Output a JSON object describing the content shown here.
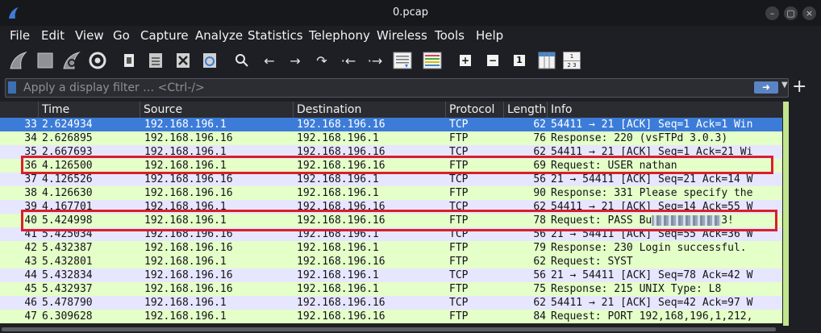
{
  "window": {
    "title": "0.pcap",
    "controls": [
      "minimize",
      "maximize",
      "close"
    ],
    "accent": "#3c7cd8"
  },
  "menu": [
    "File",
    "Edit",
    "View",
    "Go",
    "Capture",
    "Analyze",
    "Statistics",
    "Telephony",
    "Wireless",
    "Tools",
    "Help"
  ],
  "toolbar": {
    "icons": [
      "shark-fin-start-icon",
      "stop-square-icon",
      "restart-fin-icon",
      "gear-options-icon",
      "open-file-icon",
      "save-file-icon",
      "close-file-icon",
      "reload-icon",
      "search-icon",
      "arrow-left-icon",
      "arrow-right-icon",
      "go-to-packet-icon",
      "first-packet-icon",
      "last-packet-icon",
      "autoscroll-icon",
      "colorize-icon",
      "zoom-in-icon",
      "zoom-out-icon",
      "normal-size-icon",
      "resize-columns-icon",
      "layout-icon"
    ],
    "zoom_in": "+",
    "zoom_out": "−",
    "normal_size": "1",
    "layout_top": "1",
    "layout_bottom": "2 3"
  },
  "filter": {
    "placeholder": "Apply a display filter … <Ctrl-/>",
    "apply_icon": "arrow-right-icon",
    "add_button": "+"
  },
  "columns": {
    "no": "",
    "time": "Time",
    "source": "Source",
    "destination": "Destination",
    "protocol": "Protocol",
    "length": "Length",
    "info": "Info"
  },
  "packets": [
    {
      "no": "33",
      "time": "2.624934",
      "source": "192.168.196.1",
      "destination": "192.168.196.16",
      "protocol": "TCP",
      "length": "62",
      "info": "54411 → 21 [ACK] Seq=1 Ack=1 Win"
    },
    {
      "no": "34",
      "time": "2.626895",
      "source": "192.168.196.16",
      "destination": "192.168.196.1",
      "protocol": "FTP",
      "length": "76",
      "info": "Response: 220 (vsFTPd 3.0.3)"
    },
    {
      "no": "35",
      "time": "2.667693",
      "source": "192.168.196.1",
      "destination": "192.168.196.16",
      "protocol": "TCP",
      "length": "62",
      "info": "54411 → 21 [ACK] Seq=1 Ack=21 Wi"
    },
    {
      "no": "36",
      "time": "4.126500",
      "source": "192.168.196.1",
      "destination": "192.168.196.16",
      "protocol": "FTP",
      "length": "69",
      "info": "Request: USER nathan"
    },
    {
      "no": "37",
      "time": "4.126526",
      "source": "192.168.196.16",
      "destination": "192.168.196.1",
      "protocol": "TCP",
      "length": "56",
      "info": "21 → 54411 [ACK] Seq=21 Ack=14 W"
    },
    {
      "no": "38",
      "time": "4.126630",
      "source": "192.168.196.16",
      "destination": "192.168.196.1",
      "protocol": "FTP",
      "length": "90",
      "info": "Response: 331 Please specify the"
    },
    {
      "no": "39",
      "time": "4.167701",
      "source": "192.168.196.1",
      "destination": "192.168.196.16",
      "protocol": "TCP",
      "length": "62",
      "info": "54411 → 21 [ACK] Seq=14 Ack=55 W"
    },
    {
      "no": "40",
      "time": "5.424998",
      "source": "192.168.196.1",
      "destination": "192.168.196.16",
      "protocol": "FTP",
      "length": "78",
      "info": "Request: PASS Bu",
      "info_suffix": "3!"
    },
    {
      "no": "41",
      "time": "5.425034",
      "source": "192.168.196.16",
      "destination": "192.168.196.1",
      "protocol": "TCP",
      "length": "56",
      "info": "21 → 54411 [ACK] Seq=55 Ack=36 W"
    },
    {
      "no": "42",
      "time": "5.432387",
      "source": "192.168.196.16",
      "destination": "192.168.196.1",
      "protocol": "FTP",
      "length": "79",
      "info": "Response: 230 Login successful."
    },
    {
      "no": "43",
      "time": "5.432801",
      "source": "192.168.196.1",
      "destination": "192.168.196.16",
      "protocol": "FTP",
      "length": "62",
      "info": "Request: SYST"
    },
    {
      "no": "44",
      "time": "5.432834",
      "source": "192.168.196.16",
      "destination": "192.168.196.1",
      "protocol": "TCP",
      "length": "56",
      "info": "21 → 54411 [ACK] Seq=78 Ack=42 W"
    },
    {
      "no": "45",
      "time": "5.432937",
      "source": "192.168.196.16",
      "destination": "192.168.196.1",
      "protocol": "FTP",
      "length": "75",
      "info": "Response: 215 UNIX Type: L8"
    },
    {
      "no": "46",
      "time": "5.478790",
      "source": "192.168.196.1",
      "destination": "192.168.196.16",
      "protocol": "TCP",
      "length": "62",
      "info": "54411 → 21 [ACK] Seq=42 Ack=97 W"
    },
    {
      "no": "47",
      "time": "6.309628",
      "source": "192.168.196.1",
      "destination": "192.168.196.16",
      "protocol": "FTP",
      "length": "84",
      "info": "Request: PORT 192,168,196,1,212,"
    }
  ],
  "selected_packet": "33",
  "highlighted_packets": [
    "36",
    "40"
  ],
  "colors": {
    "tcp_row": "#e7e6ff",
    "ftp_row": "#e4ffc7",
    "selected_row": "#3c7cd8",
    "highlight_box": "#d81f2a"
  }
}
